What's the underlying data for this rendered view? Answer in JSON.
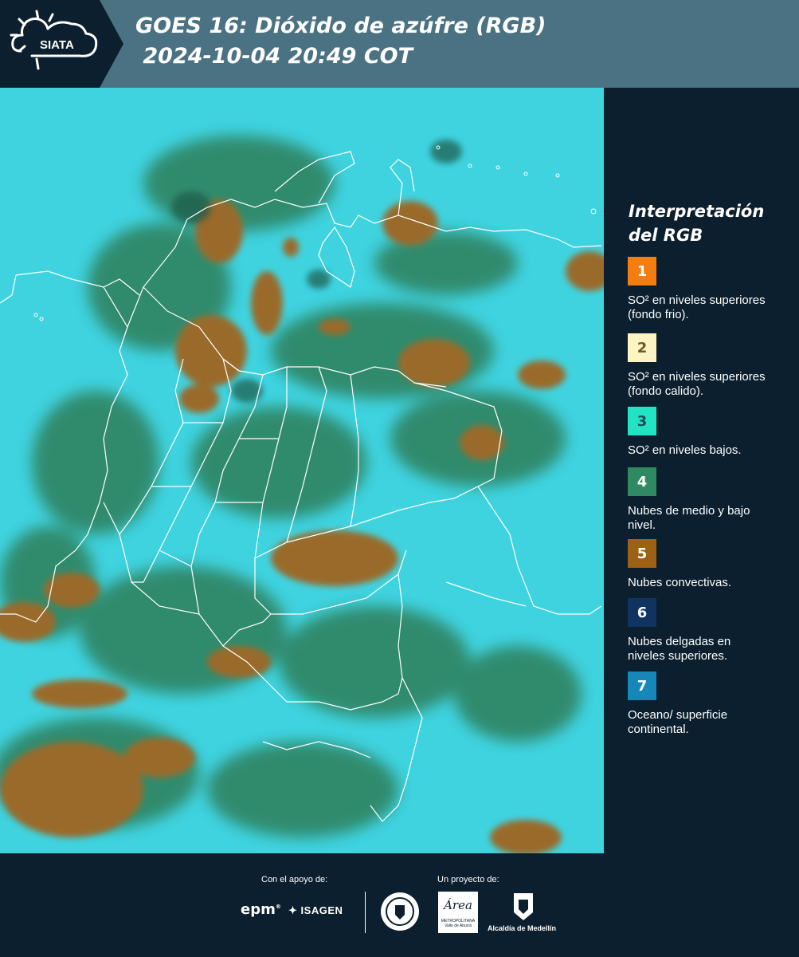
{
  "header": {
    "logo_text": "SIATA",
    "title_line1": "GOES 16: Dióxido de azúfre (RGB)",
    "title_line2": " 2024-10-04 20:49 COT"
  },
  "legend": {
    "title": "Interpretación del RGB",
    "items": [
      {
        "num": "1",
        "color": "#f47d12",
        "num_color": "#ffffff",
        "text": "SO² en niveles superiores (fondo frio)."
      },
      {
        "num": "2",
        "color": "#fdf4c4",
        "num_color": "#6a5a2a",
        "text": "SO² en niveles superiores (fondo calido)."
      },
      {
        "num": "3",
        "color": "#22e3c4",
        "num_color": "#1b4f56",
        "text": "SO² en niveles bajos."
      },
      {
        "num": "4",
        "color": "#2f8a62",
        "num_color": "#ffffff",
        "text": "Nubes de medio y bajo nivel."
      },
      {
        "num": "5",
        "color": "#9c6113",
        "num_color": "#ffffff",
        "text": "Nubes convectivas."
      },
      {
        "num": "6",
        "color": "#10345f",
        "num_color": "#ffffff",
        "text": "Nubes delgadas en niveles superiores."
      },
      {
        "num": "7",
        "color": "#1588b9",
        "num_color": "#ffffff",
        "text": "Oceano/ superficie continental."
      }
    ]
  },
  "footer": {
    "support_label": "Con el apoyo de:",
    "project_label": "Un proyecto de:",
    "epm": "epm",
    "isagen": "ISAGEN",
    "area": "Área",
    "area_sub1": "METROPOLITANA",
    "area_sub2": "Valle de Aburrá",
    "alcaldia": "Alcaldía de Medellín"
  },
  "colors": {
    "header_bg": "#4a7282",
    "panel_bg": "#0b1f2e",
    "map_cyan": "#3fd3e0",
    "map_green": "#2f7f5a",
    "map_brown": "#9a6a2a",
    "border_white": "#ffffff"
  }
}
